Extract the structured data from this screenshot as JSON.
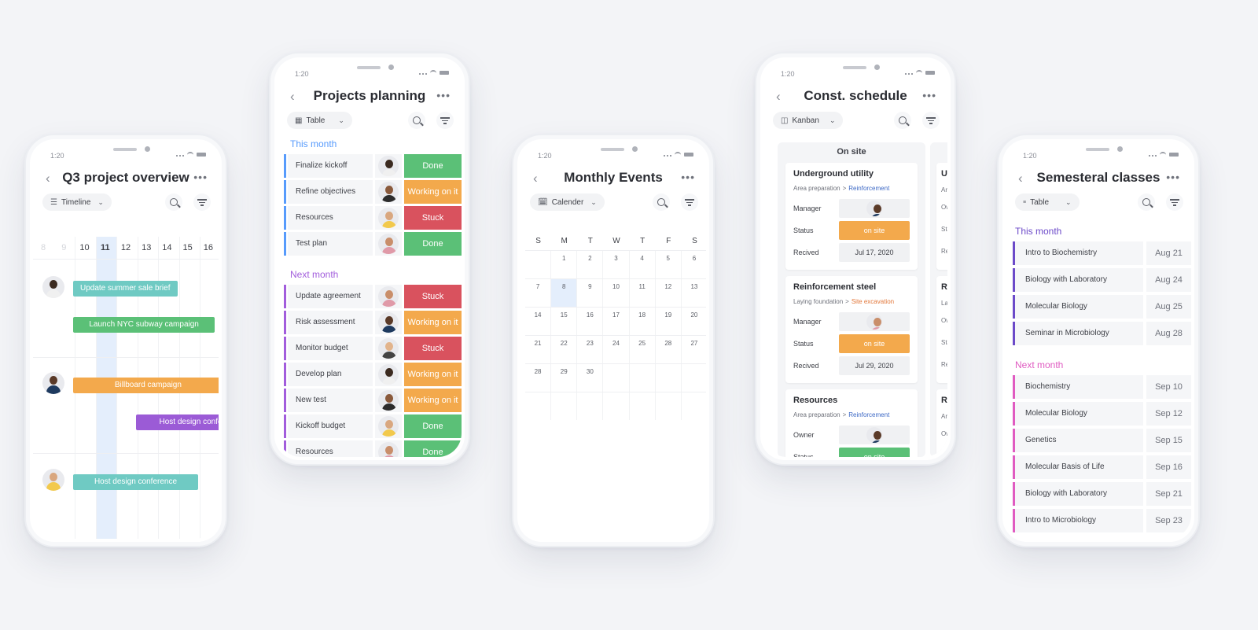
{
  "colors": {
    "done": "#5bc077",
    "working": "#f3a94c",
    "stuck": "#d9525e",
    "teal": "#6fcac3",
    "green": "#5bc077",
    "orange": "#f3a94c",
    "purple": "#9b5bd6",
    "blue_group": "#579bfc",
    "purple_group": "#a25ddc",
    "indigo_group": "#6c4ac9",
    "pink_group": "#e05bc1",
    "cal_blue": "#5f9be8",
    "cal_orange": "#e2703f",
    "cal_purple": "#6d45c2",
    "link_blue": "#3c68c5"
  },
  "common": {
    "time": "1:20",
    "back_icon": "chevron-left-icon",
    "more_icon": "ellipsis-icon",
    "search_icon": "search-icon",
    "filter_icon": "filter-icon"
  },
  "timeline": {
    "title": "Q3 project overview",
    "view": "Timeline",
    "days": [
      "8",
      "9",
      "10",
      "11",
      "12",
      "13",
      "14",
      "15",
      "16"
    ],
    "faded_days": [
      "8",
      "9"
    ],
    "today": "11",
    "bars": [
      {
        "label": "Update summer sale brief",
        "color": "teal"
      },
      {
        "label": "Launch NYC subway campaign",
        "color": "green"
      },
      {
        "label": "Billboard campaign",
        "color": "orange"
      },
      {
        "label": "Host design conference",
        "color": "purple"
      },
      {
        "label": "Host design conference",
        "color": "teal"
      }
    ]
  },
  "projects": {
    "title": "Projects planning",
    "view": "Table",
    "this_month_label": "This month",
    "next_month_label": "Next month",
    "this_month": [
      {
        "name": "Finalize kickoff",
        "status": "Done"
      },
      {
        "name": "Refine objectives",
        "status": "Working on it"
      },
      {
        "name": "Resources",
        "status": "Stuck"
      },
      {
        "name": "Test plan",
        "status": "Done"
      }
    ],
    "next_month": [
      {
        "name": "Update agreement",
        "status": "Stuck"
      },
      {
        "name": "Risk assessment",
        "status": "Working on it"
      },
      {
        "name": "Monitor budget",
        "status": "Stuck"
      },
      {
        "name": "Develop plan",
        "status": "Working on it"
      },
      {
        "name": "New test",
        "status": "Working on it"
      },
      {
        "name": "Kickoff budget",
        "status": "Done"
      },
      {
        "name": "Resources",
        "status": "Done"
      }
    ]
  },
  "calendar": {
    "title": "Monthly Events",
    "view": "Calender",
    "weekdays": [
      "S",
      "M",
      "T",
      "W",
      "T",
      "F",
      "S"
    ],
    "selected_day": "8",
    "weeks": [
      [
        {
          "d": ""
        },
        {
          "d": "1"
        },
        {
          "d": "2",
          "ev": "blue"
        },
        {
          "d": "3",
          "ev": "blue"
        },
        {
          "d": "4",
          "ev": "orange"
        },
        {
          "d": "5",
          "ev": "blue"
        },
        {
          "d": "6",
          "ev": "orange"
        }
      ],
      [
        {
          "d": "7",
          "ev": "purple"
        },
        {
          "d": "8",
          "ev": "orange"
        },
        {
          "d": "9"
        },
        {
          "d": "10"
        },
        {
          "d": "11"
        },
        {
          "d": "12"
        },
        {
          "d": "13"
        }
      ],
      [
        {
          "d": "14"
        },
        {
          "d": "15",
          "ev": "blue"
        },
        {
          "d": "16",
          "ev": "blue"
        },
        {
          "d": "17"
        },
        {
          "d": "18",
          "ev": "purple"
        },
        {
          "d": "19"
        },
        {
          "d": "20"
        }
      ],
      [
        {
          "d": "21"
        },
        {
          "d": "22",
          "ev": "orange"
        },
        {
          "d": "23"
        },
        {
          "d": "24"
        },
        {
          "d": "25",
          "ev": "orange"
        },
        {
          "d": "28",
          "ev": "orange"
        },
        {
          "d": "27"
        }
      ],
      [
        {
          "d": "28"
        },
        {
          "d": "29",
          "ev": "purple"
        },
        {
          "d": "30"
        },
        {
          "d": ""
        },
        {
          "d": ""
        },
        {
          "d": ""
        },
        {
          "d": ""
        }
      ],
      [
        {
          "d": ""
        },
        {
          "d": ""
        },
        {
          "d": ""
        },
        {
          "d": ""
        },
        {
          "d": ""
        },
        {
          "d": ""
        },
        {
          "d": ""
        }
      ]
    ]
  },
  "kanban": {
    "title": "Const. schedule",
    "view": "Kanban",
    "column_title": "On site",
    "cards": [
      {
        "title": "Underground utility",
        "crumb_from": "Area preparation",
        "crumb_sep": ">",
        "crumb_to": "Reinforcement",
        "crumb_color": "blue",
        "fields": [
          {
            "label": "Manager",
            "type": "avatar"
          },
          {
            "label": "Status",
            "type": "status",
            "value": "on site"
          },
          {
            "label": "Recived",
            "type": "text",
            "value": "Jul 17, 2020"
          }
        ]
      },
      {
        "title": "Reinforcement steel",
        "crumb_from": "Laying foundation",
        "crumb_sep": ">",
        "crumb_to": "Site excavation",
        "crumb_color": "orange",
        "fields": [
          {
            "label": "Manager",
            "type": "avatar"
          },
          {
            "label": "Status",
            "type": "status",
            "value": "on site"
          },
          {
            "label": "Recived",
            "type": "text",
            "value": "Jul 29, 2020"
          }
        ]
      },
      {
        "title": "Resources",
        "crumb_from": "Area preparation",
        "crumb_sep": ">",
        "crumb_to": "Reinforcement",
        "crumb_color": "blue",
        "fields": [
          {
            "label": "Owner",
            "type": "avatar"
          },
          {
            "label": "Status",
            "type": "status-green",
            "value": "on site"
          }
        ]
      }
    ],
    "right_column_partial": [
      {
        "title": "Un",
        "lines": [
          "Are",
          "Ow",
          "Sta",
          "Re"
        ]
      },
      {
        "title": "Re",
        "lines": [
          "Lay",
          "Ow",
          "Sta",
          "Re"
        ]
      },
      {
        "title": "Re",
        "lines": [
          "Are",
          "Ow"
        ]
      }
    ]
  },
  "semestral": {
    "title": "Semesteral classes",
    "view": "Table",
    "this_month_label": "This month",
    "next_month_label": "Next month",
    "this_month": [
      {
        "name": "Intro to Biochemistry",
        "date": "Aug 21"
      },
      {
        "name": "Biology with Laboratory",
        "date": "Aug 24"
      },
      {
        "name": "Molecular Biology",
        "date": "Aug 25"
      },
      {
        "name": "Seminar in Microbiology",
        "date": "Aug 28"
      }
    ],
    "next_month": [
      {
        "name": "Biochemistry",
        "date": "Sep 10"
      },
      {
        "name": "Molecular Biology",
        "date": "Sep 12"
      },
      {
        "name": "Genetics",
        "date": "Sep 15"
      },
      {
        "name": "Molecular Basis of Life",
        "date": "Sep 16"
      },
      {
        "name": "Biology with Laboratory",
        "date": "Sep 21"
      },
      {
        "name": "Intro to Microbiology",
        "date": "Sep 23"
      }
    ]
  }
}
